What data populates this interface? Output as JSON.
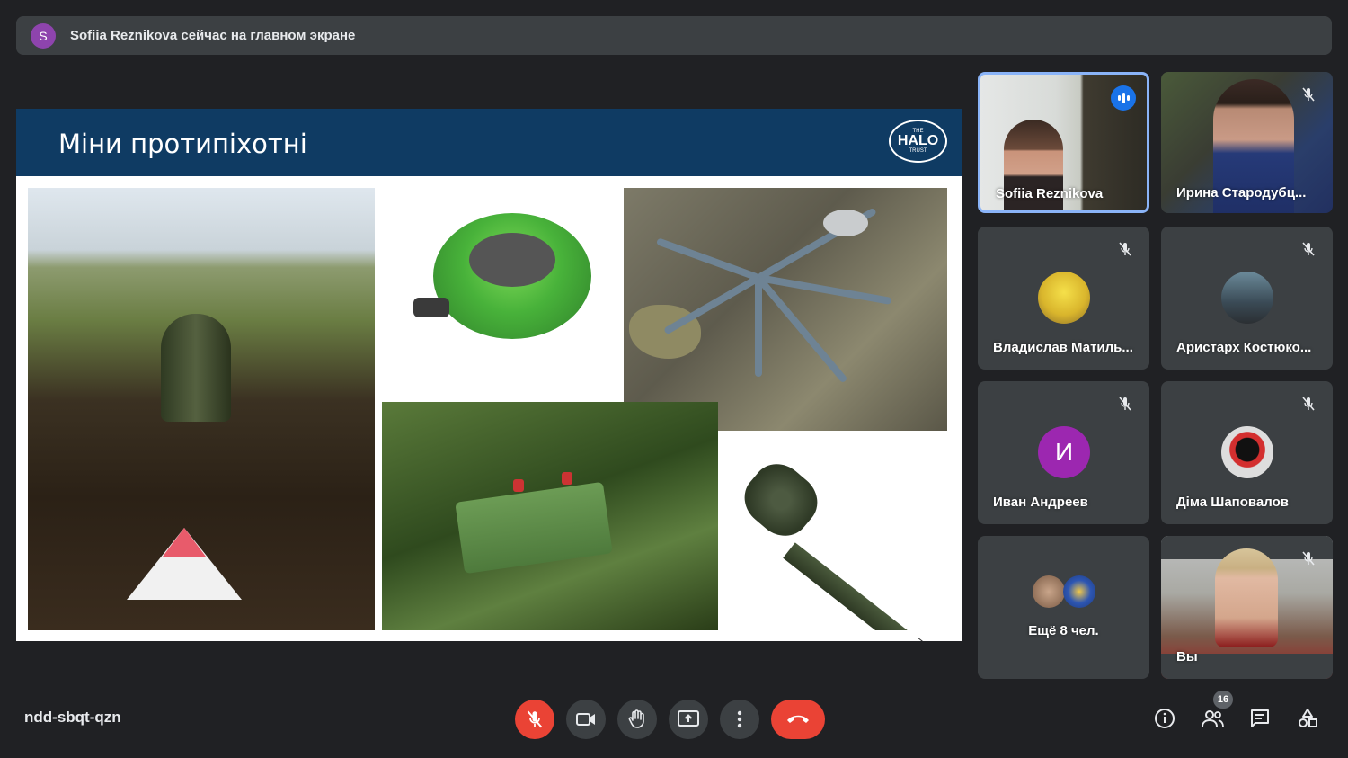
{
  "banner": {
    "avatar_letter": "S",
    "text": "Sofiia Reznikova сейчас на главном экране"
  },
  "slide": {
    "title": "Міни протипіхотні",
    "logo_top": "THE",
    "logo_main": "HALO",
    "logo_bottom": "TRUST"
  },
  "participants": [
    {
      "name": "Sofiia Reznikova",
      "speaking": true
    },
    {
      "name": "Ирина Стародубц...",
      "muted": true
    },
    {
      "name": "Владислав Матиль...",
      "muted": true
    },
    {
      "name": "Аристарх Костюко...",
      "muted": true
    },
    {
      "name": "Иван Андреев",
      "avatar_letter": "И",
      "avatar_color": "#9c27b0",
      "muted": true
    },
    {
      "name": "Діма Шаповалов",
      "muted": true
    },
    {
      "name": "Ещё 8 чел."
    },
    {
      "name": "Вы",
      "muted": true
    }
  ],
  "footer": {
    "meeting_code": "ndd-sbqt-qzn",
    "participants_count": "16"
  },
  "colors": {
    "background": "#202124",
    "tile": "#3c4043",
    "end_call": "#ea4335",
    "active_border": "#8ab4f8"
  }
}
